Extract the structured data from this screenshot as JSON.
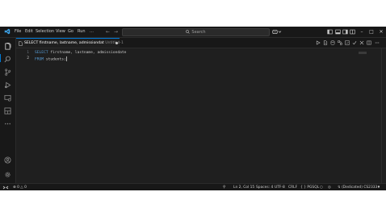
{
  "menu": [
    "File",
    "Edit",
    "Selection",
    "View",
    "Go",
    "Run",
    "…"
  ],
  "search": {
    "label": "Search"
  },
  "tab": {
    "title": "SELECT firstname, lastname, admissiondat",
    "subtitle": "Untitled-1"
  },
  "editor": {
    "lines": [
      {
        "number": "1",
        "keyword": "SELECT",
        "rest": " firstname, lastname, admissiondate"
      },
      {
        "number": "2",
        "keyword": "FROM",
        "rest": " students;"
      }
    ]
  },
  "status": {
    "problems": "0",
    "warnings": "0",
    "position": "Ln 2, Col 15",
    "spaces": "Spaces: 4",
    "encoding": "UTF-8",
    "eol": "CRLF",
    "language": "{ } PGSQL",
    "connection": "(Dedicated) CS2333"
  },
  "colors": {
    "accent": "#0078d4",
    "keyword": "#569cd6",
    "background": "#1f1f1f",
    "chrome": "#181818"
  }
}
